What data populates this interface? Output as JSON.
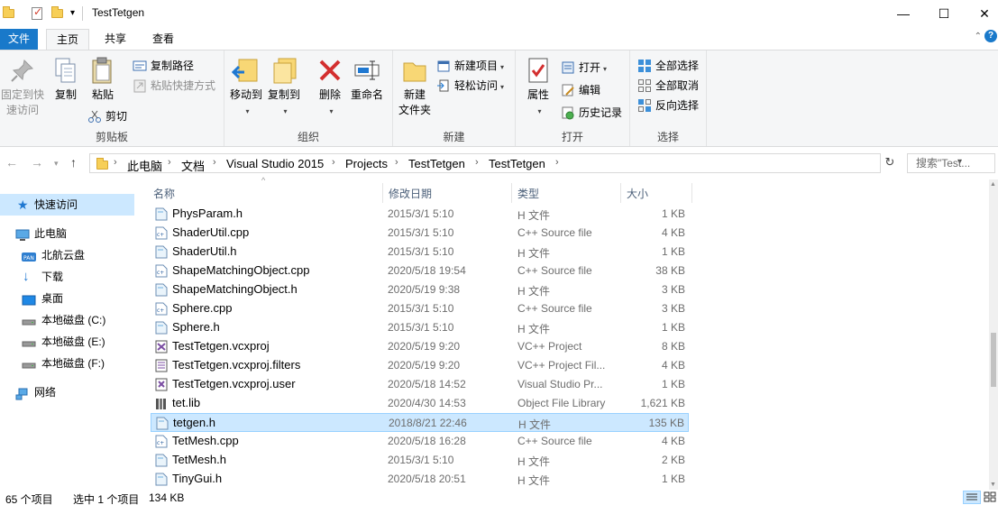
{
  "window": {
    "title": "TestTetgen",
    "buttons": {
      "minimize": "—",
      "maximize": "☐",
      "close": "✕"
    },
    "qa_dropdown": "▾"
  },
  "ribbon_tabs": [
    "文件",
    "主页",
    "共享",
    "查看"
  ],
  "ribbon_extra": {
    "collapse": "⌃",
    "help": "?"
  },
  "ribbon": {
    "clipboard": {
      "label": "剪贴板",
      "pin": "固定到快\n速访问",
      "copy": "复制",
      "paste": "粘贴",
      "cut": "剪切",
      "copy_path": "复制路径",
      "paste_shortcut": "粘贴快捷方式"
    },
    "organize": {
      "label": "组织",
      "move_to": "移动到",
      "copy_to": "复制到",
      "delete": "删除",
      "rename": "重命名"
    },
    "new": {
      "label": "新建",
      "new_folder": "新建\n文件夹",
      "new_item": "新建项目",
      "easy_access": "轻松访问"
    },
    "open": {
      "label": "打开",
      "properties": "属性",
      "open": "打开",
      "edit": "编辑",
      "history": "历史记录"
    },
    "select": {
      "label": "选择",
      "select_all": "全部选择",
      "select_none": "全部取消",
      "invert": "反向选择"
    }
  },
  "nav": {
    "breadcrumb": [
      "此电脑",
      "文档",
      "Visual Studio 2015",
      "Projects",
      "TestTetgen",
      "TestTetgen"
    ],
    "search_placeholder": "搜索\"Test..."
  },
  "sidebar": [
    {
      "label": "快速访问",
      "icon": "star-icon",
      "selected": true
    },
    {
      "label": "此电脑",
      "icon": "computer-icon",
      "selected": false
    },
    {
      "label": "北航云盘",
      "icon": "cloud-drive-icon",
      "selected": false
    },
    {
      "label": "下载",
      "icon": "download-icon",
      "selected": false
    },
    {
      "label": "桌面",
      "icon": "desktop-icon",
      "selected": false
    },
    {
      "label": "本地磁盘 (C:)",
      "icon": "drive-icon",
      "selected": false
    },
    {
      "label": "本地磁盘 (E:)",
      "icon": "drive-icon",
      "selected": false
    },
    {
      "label": "本地磁盘 (F:)",
      "icon": "drive-icon",
      "selected": false
    },
    {
      "label": "网络",
      "icon": "network-icon",
      "selected": false
    }
  ],
  "columns": {
    "name": "名称",
    "date": "修改日期",
    "type": "类型",
    "size": "大小"
  },
  "files": [
    {
      "name": "PhysParam.h",
      "date": "2015/3/1 5:10",
      "type": "H 文件",
      "size": "1 KB",
      "icon": "h"
    },
    {
      "name": "ShaderUtil.cpp",
      "date": "2015/3/1 5:10",
      "type": "C++ Source file",
      "size": "4 KB",
      "icon": "cpp"
    },
    {
      "name": "ShaderUtil.h",
      "date": "2015/3/1 5:10",
      "type": "H 文件",
      "size": "1 KB",
      "icon": "h"
    },
    {
      "name": "ShapeMatchingObject.cpp",
      "date": "2020/5/18 19:54",
      "type": "C++ Source file",
      "size": "38 KB",
      "icon": "cpp"
    },
    {
      "name": "ShapeMatchingObject.h",
      "date": "2020/5/19 9:38",
      "type": "H 文件",
      "size": "3 KB",
      "icon": "h"
    },
    {
      "name": "Sphere.cpp",
      "date": "2015/3/1 5:10",
      "type": "C++ Source file",
      "size": "3 KB",
      "icon": "cpp"
    },
    {
      "name": "Sphere.h",
      "date": "2015/3/1 5:10",
      "type": "H 文件",
      "size": "1 KB",
      "icon": "h"
    },
    {
      "name": "TestTetgen.vcxproj",
      "date": "2020/5/19 9:20",
      "type": "VC++ Project",
      "size": "8 KB",
      "icon": "proj"
    },
    {
      "name": "TestTetgen.vcxproj.filters",
      "date": "2020/5/19 9:20",
      "type": "VC++ Project Fil...",
      "size": "4 KB",
      "icon": "filters"
    },
    {
      "name": "TestTetgen.vcxproj.user",
      "date": "2020/5/18 14:52",
      "type": "Visual Studio Pr...",
      "size": "1 KB",
      "icon": "user"
    },
    {
      "name": "tet.lib",
      "date": "2020/4/30 14:53",
      "type": "Object File Library",
      "size": "1,621 KB",
      "icon": "lib"
    },
    {
      "name": "tetgen.h",
      "date": "2018/8/21 22:46",
      "type": "H 文件",
      "size": "135 KB",
      "icon": "h",
      "selected": true
    },
    {
      "name": "TetMesh.cpp",
      "date": "2020/5/18 16:28",
      "type": "C++ Source file",
      "size": "4 KB",
      "icon": "cpp"
    },
    {
      "name": "TetMesh.h",
      "date": "2015/3/1 5:10",
      "type": "H 文件",
      "size": "2 KB",
      "icon": "h"
    },
    {
      "name": "TinyGui.h",
      "date": "2020/5/18 20:51",
      "type": "H 文件",
      "size": "1 KB",
      "icon": "h"
    }
  ],
  "status": {
    "count": "65 个项目",
    "selected": "选中 1 个项目",
    "size": "134 KB"
  }
}
